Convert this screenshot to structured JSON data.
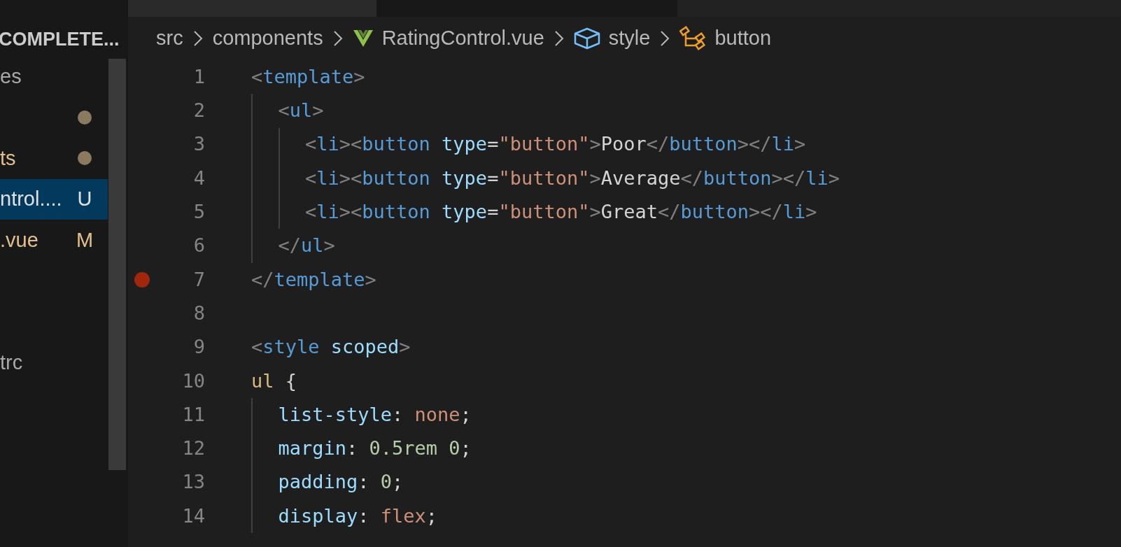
{
  "sidebar": {
    "header": "COMPLETE...",
    "items": [
      {
        "label": "es",
        "color": "#a8a8a8",
        "dot": false,
        "selected": false
      },
      {
        "dot": true,
        "selected": false
      },
      {
        "label": "ts",
        "color": "#e2c08d",
        "dot": true,
        "selected": false
      },
      {
        "label": "ntrol....",
        "badge": "U",
        "color": "#e0e0e0",
        "dot": false,
        "selected": true
      },
      {
        "label": ".vue",
        "badge": "M",
        "color": "#e2c08d",
        "dot": false,
        "selected": false
      },
      {
        "label": "trc",
        "color": "#a8a8a8",
        "dot": false,
        "selected": false
      }
    ]
  },
  "breadcrumb": [
    {
      "label": "src",
      "kind": "folder"
    },
    {
      "label": "components",
      "kind": "folder"
    },
    {
      "label": "RatingControl.vue",
      "kind": "vue"
    },
    {
      "label": "style",
      "kind": "module"
    },
    {
      "label": "button",
      "kind": "selector"
    }
  ],
  "editor": {
    "lines": [
      {
        "number": "1",
        "breakpoint": false,
        "tokens": [
          {
            "t": "<",
            "kind": "punct"
          },
          {
            "t": "template",
            "kind": "tag"
          },
          {
            "t": ">",
            "kind": "punct"
          }
        ],
        "children": [
          {
            "number": "2",
            "breakpoint": false,
            "tokens": [
              {
                "t": "<",
                "kind": "punct"
              },
              {
                "t": "ul",
                "kind": "tag"
              },
              {
                "t": ">",
                "kind": "punct"
              }
            ],
            "children": [
              {
                "number": "3",
                "breakpoint": false,
                "tokens": [
                  {
                    "t": "<",
                    "kind": "punct"
                  },
                  {
                    "t": "li",
                    "kind": "tag"
                  },
                  {
                    "t": "><",
                    "kind": "punct"
                  },
                  {
                    "t": "button",
                    "kind": "tag"
                  },
                  {
                    "t": " type",
                    "kind": "attr"
                  },
                  {
                    "t": "=",
                    "kind": "text"
                  },
                  {
                    "t": "\"button\"",
                    "kind": "str"
                  },
                  {
                    "t": ">",
                    "kind": "punct"
                  },
                  {
                    "t": "Poor",
                    "kind": "text"
                  },
                  {
                    "t": "</",
                    "kind": "punct"
                  },
                  {
                    "t": "button",
                    "kind": "tag"
                  },
                  {
                    "t": "></",
                    "kind": "punct"
                  },
                  {
                    "t": "li",
                    "kind": "tag"
                  },
                  {
                    "t": ">",
                    "kind": "punct"
                  }
                ]
              },
              {
                "number": "4",
                "breakpoint": false,
                "tokens": [
                  {
                    "t": "<",
                    "kind": "punct"
                  },
                  {
                    "t": "li",
                    "kind": "tag"
                  },
                  {
                    "t": "><",
                    "kind": "punct"
                  },
                  {
                    "t": "button",
                    "kind": "tag"
                  },
                  {
                    "t": " type",
                    "kind": "attr"
                  },
                  {
                    "t": "=",
                    "kind": "text"
                  },
                  {
                    "t": "\"button\"",
                    "kind": "str"
                  },
                  {
                    "t": ">",
                    "kind": "punct"
                  },
                  {
                    "t": "Average",
                    "kind": "text"
                  },
                  {
                    "t": "</",
                    "kind": "punct"
                  },
                  {
                    "t": "button",
                    "kind": "tag"
                  },
                  {
                    "t": "></",
                    "kind": "punct"
                  },
                  {
                    "t": "li",
                    "kind": "tag"
                  },
                  {
                    "t": ">",
                    "kind": "punct"
                  }
                ]
              },
              {
                "number": "5",
                "breakpoint": false,
                "tokens": [
                  {
                    "t": "<",
                    "kind": "punct"
                  },
                  {
                    "t": "li",
                    "kind": "tag"
                  },
                  {
                    "t": "><",
                    "kind": "punct"
                  },
                  {
                    "t": "button",
                    "kind": "tag"
                  },
                  {
                    "t": " type",
                    "kind": "attr"
                  },
                  {
                    "t": "=",
                    "kind": "text"
                  },
                  {
                    "t": "\"button\"",
                    "kind": "str"
                  },
                  {
                    "t": ">",
                    "kind": "punct"
                  },
                  {
                    "t": "Great",
                    "kind": "text"
                  },
                  {
                    "t": "</",
                    "kind": "punct"
                  },
                  {
                    "t": "button",
                    "kind": "tag"
                  },
                  {
                    "t": "></",
                    "kind": "punct"
                  },
                  {
                    "t": "li",
                    "kind": "tag"
                  },
                  {
                    "t": ">",
                    "kind": "punct"
                  }
                ]
              }
            ]
          },
          {
            "number": "6",
            "breakpoint": false,
            "tokens": [
              {
                "t": "</",
                "kind": "punct"
              },
              {
                "t": "ul",
                "kind": "tag"
              },
              {
                "t": ">",
                "kind": "punct"
              }
            ]
          }
        ]
      },
      {
        "number": "7",
        "breakpoint": true,
        "tokens": [
          {
            "t": "</",
            "kind": "punct"
          },
          {
            "t": "template",
            "kind": "tag"
          },
          {
            "t": ">",
            "kind": "punct"
          }
        ]
      },
      {
        "number": "8",
        "breakpoint": false
      },
      {
        "number": "9",
        "breakpoint": false,
        "tokens": [
          {
            "t": "<",
            "kind": "punct"
          },
          {
            "t": "style",
            "kind": "tag"
          },
          {
            "t": " scoped",
            "kind": "attr"
          },
          {
            "t": ">",
            "kind": "punct"
          }
        ]
      },
      {
        "number": "10",
        "breakpoint": false,
        "tokens": [
          {
            "t": "ul",
            "kind": "selector"
          },
          {
            "t": " {",
            "kind": "text"
          }
        ],
        "children": [
          {
            "number": "11",
            "breakpoint": false,
            "tokens": [
              {
                "t": "list-style",
                "kind": "prop"
              },
              {
                "t": ": ",
                "kind": "text"
              },
              {
                "t": "none",
                "kind": "str"
              },
              {
                "t": ";",
                "kind": "text"
              }
            ]
          },
          {
            "number": "12",
            "breakpoint": false,
            "tokens": [
              {
                "t": "margin",
                "kind": "prop"
              },
              {
                "t": ": ",
                "kind": "text"
              },
              {
                "t": "0.5rem 0",
                "kind": "num"
              },
              {
                "t": ";",
                "kind": "text"
              }
            ]
          },
          {
            "number": "13",
            "breakpoint": false,
            "tokens": [
              {
                "t": "padding",
                "kind": "prop"
              },
              {
                "t": ": ",
                "kind": "text"
              },
              {
                "t": "0",
                "kind": "num"
              },
              {
                "t": ";",
                "kind": "text"
              }
            ]
          },
          {
            "number": "14",
            "breakpoint": false,
            "tokens": [
              {
                "t": "display",
                "kind": "prop"
              },
              {
                "t": ": ",
                "kind": "text"
              },
              {
                "t": "flex",
                "kind": "str"
              },
              {
                "t": ";",
                "kind": "text"
              }
            ]
          }
        ]
      }
    ]
  }
}
